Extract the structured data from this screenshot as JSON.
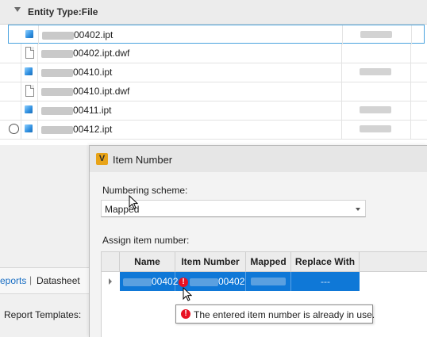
{
  "file_grid": {
    "group_header": "Entity Type:File",
    "rows": [
      {
        "icon": "ipt-part-icon",
        "filename_suffix": "00402.ipt",
        "selected": true
      },
      {
        "icon": "document-icon",
        "filename_suffix": "00402.ipt.dwf",
        "selected": false
      },
      {
        "icon": "ipt-part-icon",
        "filename_suffix": "00410.ipt",
        "selected": false
      },
      {
        "icon": "document-icon",
        "filename_suffix": "00410.ipt.dwf",
        "selected": false
      },
      {
        "icon": "ipt-part-icon",
        "filename_suffix": "00411.ipt",
        "selected": false
      },
      {
        "icon": "ipt-part-icon",
        "filename_suffix": "00412.ipt",
        "selected": false
      }
    ]
  },
  "background_panel": {
    "tab_reports": "eports",
    "tab_separator": "|",
    "tab_datasheet": "Datasheet",
    "report_templates_label": "Report Templates:"
  },
  "dialog": {
    "app_icon_letter": "V",
    "title": "Item Number",
    "numbering_scheme_label": "Numbering scheme:",
    "numbering_scheme_value": "Mapped",
    "assign_label": "Assign item number:",
    "columns": [
      "Name",
      "Item Number",
      "Mapped",
      "Replace With"
    ],
    "row": {
      "name_suffix": "00402",
      "item_number_suffix": "00402",
      "replace_with": "---"
    },
    "error_glyph": "!",
    "tooltip": "The entered item number is already in use."
  },
  "colors": {
    "selection_blue": "#0f78d7",
    "error_red": "#e81123",
    "link_blue": "#1a6fc4",
    "app_icon_orange": "#e8a317"
  }
}
